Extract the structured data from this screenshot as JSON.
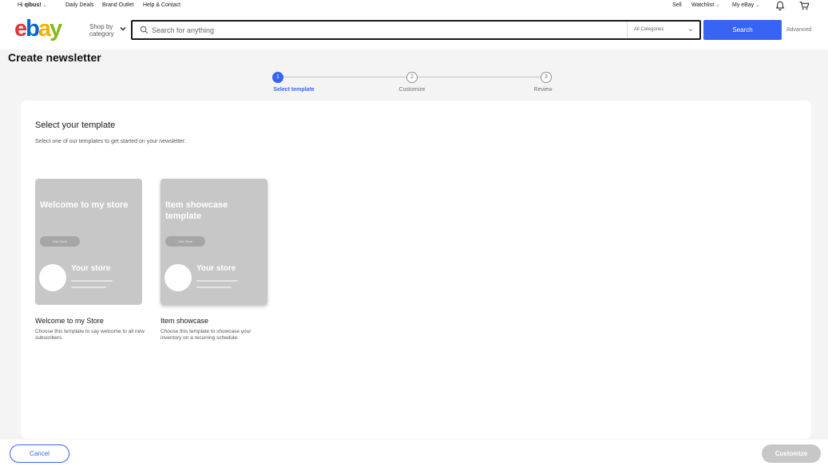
{
  "topbar": {
    "greeting_prefix": "Hi ",
    "username": "qibus!",
    "links": [
      "Daily Deals",
      "Brand Outlet",
      "Help & Contact"
    ],
    "sell": "Sell",
    "watchlist": "Watchlist",
    "myebay": "My eBay"
  },
  "header": {
    "logo_letters": [
      "e",
      "b",
      "a",
      "y"
    ],
    "logo_colors": [
      "#e53238",
      "#0064d2",
      "#f5af02",
      "#86b817"
    ],
    "shop_by_line1": "Shop by",
    "shop_by_line2": "category",
    "search_placeholder": "Search for anything",
    "category_select": "All Categories",
    "search_button": "Search",
    "advanced": "Advanced"
  },
  "page": {
    "title": "Create newsletter"
  },
  "stepper": {
    "steps": [
      {
        "number": "1",
        "label": "Select template",
        "state": "active"
      },
      {
        "number": "2",
        "label": "Customize",
        "state": "todo"
      },
      {
        "number": "3",
        "label": "Review",
        "state": "todo"
      }
    ]
  },
  "card": {
    "title": "Select your template",
    "subtitle": "Select one of our templates to get started on your newsletter.",
    "templates": [
      {
        "thumb_heading": "Welcome to my store",
        "thumb_button": "Visit Store",
        "thumb_store": "Your store",
        "name": "Welcome to my Store",
        "description": "Choose this template to say welcome to all new subscribers."
      },
      {
        "thumb_heading": "Item showcase template",
        "thumb_button": "Visit Store",
        "thumb_store": "Your store",
        "name": "Item showcase",
        "description": "Choose this template to showcase your inventory on a recurring schedule."
      }
    ]
  },
  "footer": {
    "cancel": "Cancel",
    "customize": "Customize"
  },
  "colors": {
    "accent": "#3665f3",
    "disabled": "#c7c7c7",
    "thumb_bg": "#c7c7c7"
  }
}
